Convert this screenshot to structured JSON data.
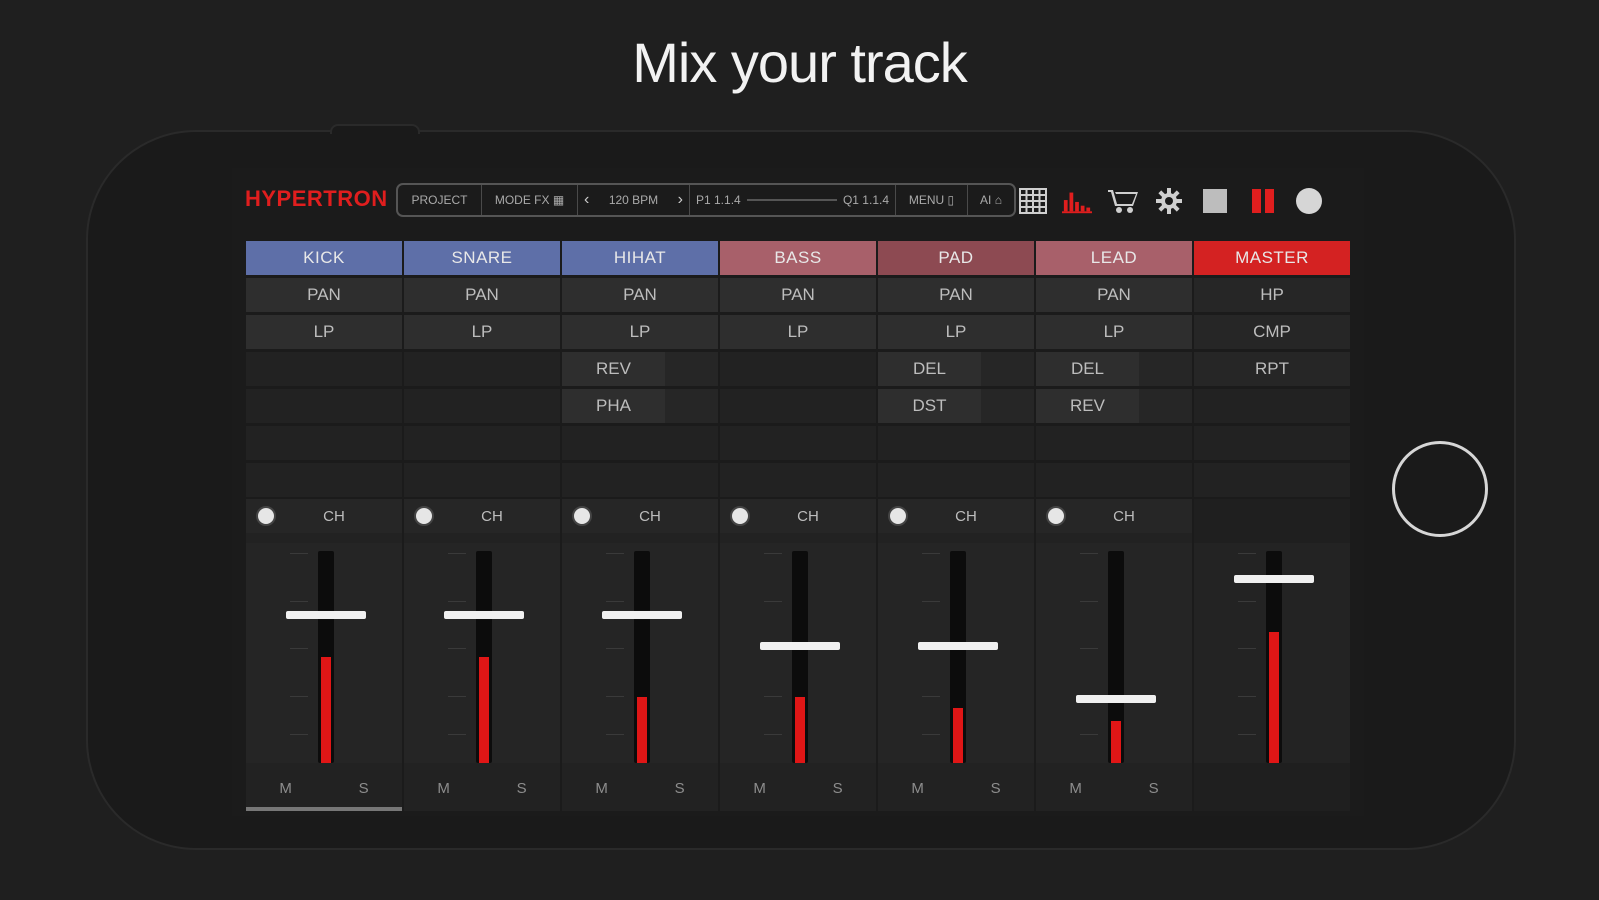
{
  "headline": "Mix your track",
  "app": {
    "logo": "HYPERTRON",
    "toolbar": {
      "project": "PROJECT",
      "mode": "MODE FX ▦",
      "bpm": "120 BPM",
      "position_left": "P1 1.1.4",
      "position_right": "Q1 1.1.4",
      "menu": "MENU ▯",
      "ai": "AI ⌂"
    },
    "icons": [
      "grid-icon",
      "equalizer-icon",
      "cart-icon",
      "gear-icon",
      "stop-icon",
      "pause-icon",
      "record-icon"
    ],
    "colors": {
      "accent": "#e01e1e",
      "drum": "#5e6fa8",
      "synth": "#a8606a",
      "master": "#d42222"
    }
  },
  "tracks": [
    {
      "name": "KICK",
      "color": "#5e6fa8",
      "fx": [
        "PAN",
        "LP"
      ],
      "ch": "CH",
      "fader": 0.7,
      "meter": 0.5,
      "mute": "M",
      "solo": "S"
    },
    {
      "name": "SNARE",
      "color": "#5e6fa8",
      "fx": [
        "PAN",
        "LP"
      ],
      "ch": "CH",
      "fader": 0.7,
      "meter": 0.5,
      "mute": "M",
      "solo": "S"
    },
    {
      "name": "HIHAT",
      "color": "#5e6fa8",
      "fx": [
        "PAN",
        "LP",
        "REV",
        "PHA"
      ],
      "ch": "CH",
      "fader": 0.7,
      "meter": 0.31,
      "mute": "M",
      "solo": "S"
    },
    {
      "name": "BASS",
      "color": "#a8606a",
      "fx": [
        "PAN",
        "LP"
      ],
      "ch": "CH",
      "fader": 0.55,
      "meter": 0.31,
      "mute": "M",
      "solo": "S"
    },
    {
      "name": "PAD",
      "color": "#8d4a52",
      "fx": [
        "PAN",
        "LP",
        "DEL",
        "DST"
      ],
      "ch": "CH",
      "fader": 0.55,
      "meter": 0.26,
      "mute": "M",
      "solo": "S"
    },
    {
      "name": "LEAD",
      "color": "#a8606a",
      "fx": [
        "PAN",
        "LP",
        "DEL",
        "REV"
      ],
      "ch": "CH",
      "fader": 0.3,
      "meter": 0.2,
      "mute": "M",
      "solo": "S"
    }
  ],
  "master": {
    "name": "MASTER",
    "color": "#d42222",
    "fx": [
      "HP",
      "CMP",
      "RPT"
    ],
    "fader": 0.87,
    "meter": 0.62
  }
}
